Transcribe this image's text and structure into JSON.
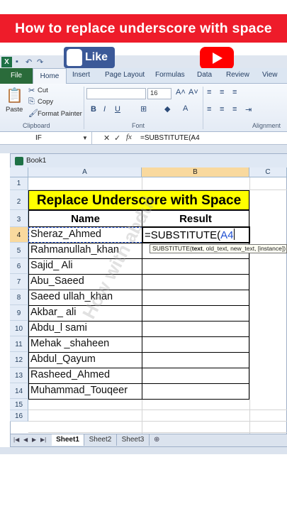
{
  "banner": {
    "title": "How to replace underscore with space"
  },
  "overlays": {
    "like_label": "Like"
  },
  "tabs": [
    "File",
    "Home",
    "Insert",
    "Page Layout",
    "Formulas",
    "Data",
    "Review",
    "View"
  ],
  "ribbon": {
    "paste": "Paste",
    "cut": "Cut",
    "copy": "Copy",
    "format_painter": "Format Painter",
    "font_size": "16",
    "clipboard_label": "Clipboard",
    "font_label": "Font",
    "alignment_label": "Alignment"
  },
  "formula_bar": {
    "name_box": "IF",
    "cancel": "✕",
    "enter": "✓",
    "fx": "fx",
    "content": "=SUBSTITUTE(A4"
  },
  "workbook": {
    "title": "Book1"
  },
  "columns": [
    "A",
    "B",
    "C"
  ],
  "rows": [
    "1",
    "2",
    "3",
    "4",
    "5",
    "6",
    "7",
    "8",
    "9",
    "10",
    "11",
    "12",
    "13",
    "14",
    "15",
    "16"
  ],
  "sheet": {
    "title": "Replace Underscore with Space",
    "header_name": "Name",
    "header_result": "Result",
    "names": [
      "Sheraz_Ahmed",
      "Rahmanullah_khan",
      "Sajid_ Ali",
      "Abu_Saeed",
      "Saeed ullah_khan",
      "Akbar_ ali",
      "Abdu_l sami",
      "Mehak _shaheen",
      "Abdul_Qayum",
      "Rasheed_Ahmed",
      "Muhammad_Touqeer"
    ],
    "formula_prefix": "=SUBSTITUTE(",
    "formula_ref": "A4",
    "tooltip_fn": "SUBSTITUTE(",
    "tooltip_arg1": "text",
    "tooltip_rest": ", old_text, new_text, [instance])"
  },
  "watermark": "How with abdul",
  "sheet_tabs": [
    "Sheet1",
    "Sheet2",
    "Sheet3"
  ],
  "colors": {
    "banner": "#ee1c2a",
    "title_fill": "#ffff00",
    "selected_header": "#f9d99e",
    "file_tab": "#2a6b3a"
  }
}
